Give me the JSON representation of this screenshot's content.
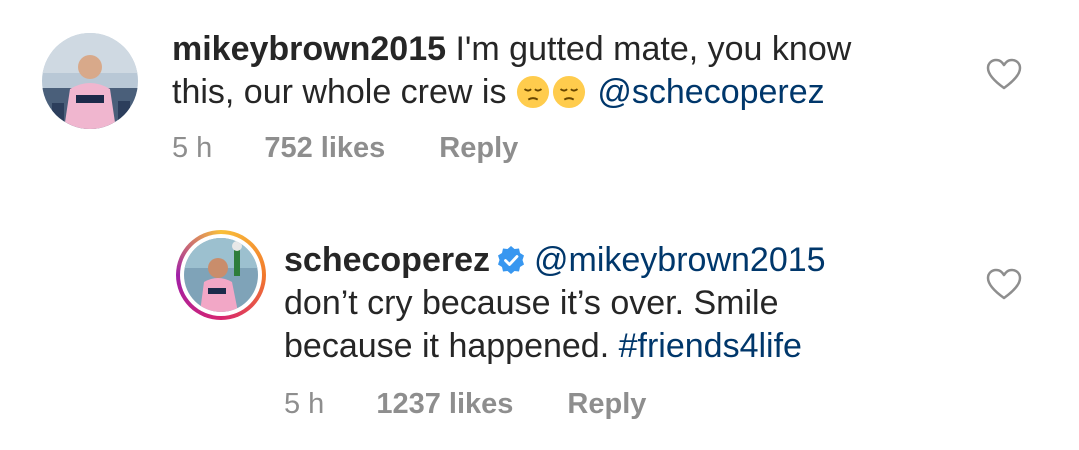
{
  "comments": [
    {
      "username": "mikeybrown2015",
      "text_line1": " I'm gutted mate,  you know",
      "text_line2_prefix": "this, our whole crew is ",
      "emoji": [
        "pensive-face",
        "pensive-face"
      ],
      "mention": "@schecoperez",
      "time": "5 h",
      "likes": "752 likes",
      "reply": "Reply",
      "verified": false
    },
    {
      "username": "schecoperez",
      "verified": true,
      "mention": "@mikeybrown2015",
      "text_line2": "don’t cry because it’s over. Smile",
      "text_line3_prefix": "because it happened. ",
      "hashtag": "#friends4life",
      "time": "5 h",
      "likes": "1237 likes",
      "reply": "Reply",
      "has_story_ring": true
    }
  ],
  "icons": {
    "like": "heart-outline-icon",
    "verified": "verified-badge-icon"
  },
  "colors": {
    "text": "#262626",
    "meta": "#8e8e8e",
    "link": "#00376b",
    "verified": "#3897f0",
    "emoji": "#ffcc4d"
  }
}
